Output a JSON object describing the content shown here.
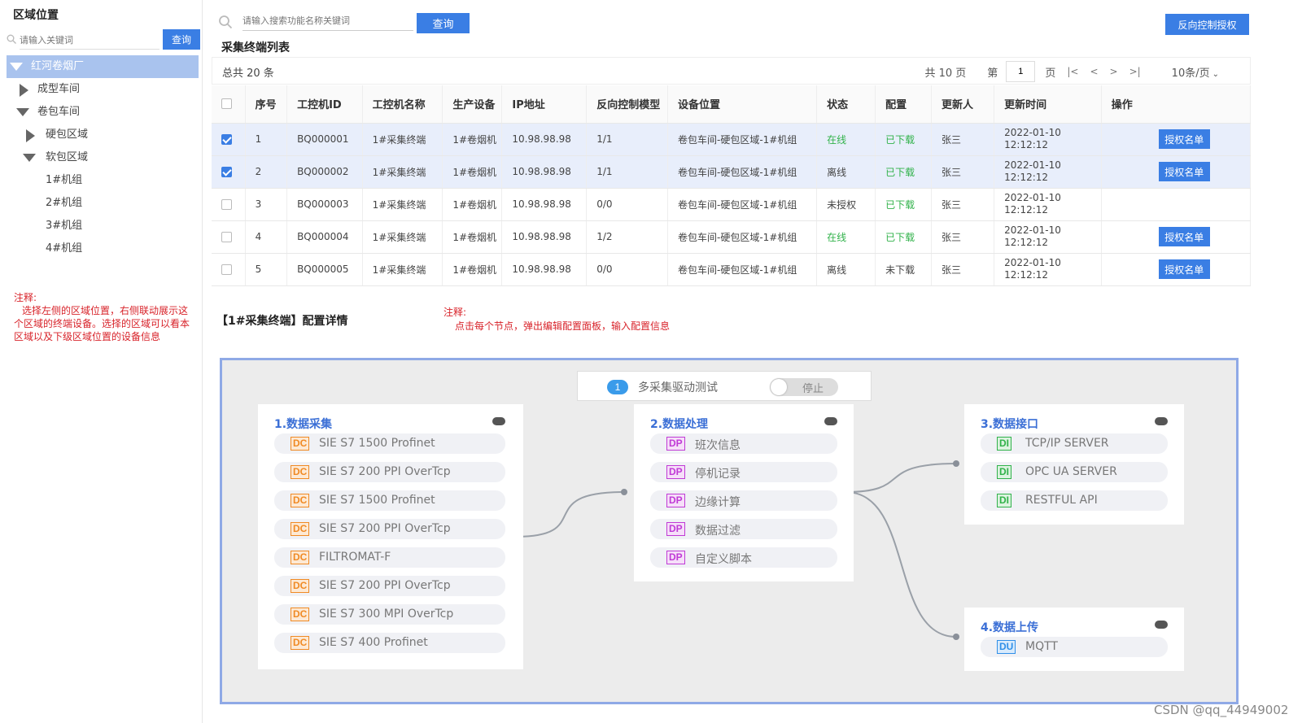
{
  "left_panel": {
    "title": "区域位置",
    "search_placeholder": "请输入关键词",
    "search_button": "查询",
    "tree": [
      {
        "label": "红河卷烟厂"
      },
      {
        "label": "成型车间"
      },
      {
        "label": "卷包车间"
      },
      {
        "label": "硬包区域"
      },
      {
        "label": "软包区域"
      },
      {
        "label": "1#机组"
      },
      {
        "label": "2#机组"
      },
      {
        "label": "3#机组"
      },
      {
        "label": "4#机组"
      }
    ],
    "note_title": "注释:",
    "note_text": "选择左侧的区域位置，右侧联动展示这个区域的终端设备。选择的区域可以看本区域以及下级区域位置的设备信息"
  },
  "top_bar": {
    "search_placeholder": "请输入搜索功能名称关键词",
    "search_button": "查询",
    "auth_button": "反向控制授权"
  },
  "list": {
    "title": "采集终端列表",
    "total": "总共 20 条",
    "pages": "共 10 页",
    "page_prefix": "第",
    "page_value": "1",
    "page_suffix": "页",
    "nav_first": "|<",
    "nav_prev": "<",
    "nav_next": ">",
    "nav_last": ">|",
    "page_size": "10条/页",
    "columns": [
      "序号",
      "工控机ID",
      "工控机名称",
      "生产设备",
      "IP地址",
      "反向控制模型",
      "设备位置",
      "状态",
      "配置",
      "更新人",
      "更新时间",
      "操作"
    ],
    "rows": [
      {
        "checked": true,
        "no": "1",
        "id": "BQ000001",
        "name": "1#采集终端",
        "device": "1#卷烟机",
        "ip": "10.98.98.98",
        "model": "1/1",
        "location": "卷包车间-硬包区域-1#机组",
        "status": "在线",
        "config": "已下载",
        "updater": "张三",
        "date": "2022-01-10",
        "time": "12:12:12",
        "action": "授权名单"
      },
      {
        "checked": true,
        "no": "2",
        "id": "BQ000002",
        "name": "1#采集终端",
        "device": "1#卷烟机",
        "ip": "10.98.98.98",
        "model": "1/1",
        "location": "卷包车间-硬包区域-1#机组",
        "status": "离线",
        "config": "已下载",
        "updater": "张三",
        "date": "2022-01-10",
        "time": "12:12:12",
        "action": "授权名单"
      },
      {
        "checked": false,
        "no": "3",
        "id": "BQ000003",
        "name": "1#采集终端",
        "device": "1#卷烟机",
        "ip": "10.98.98.98",
        "model": "0/0",
        "location": "卷包车间-硬包区域-1#机组",
        "status": "未授权",
        "config": "已下载",
        "updater": "张三",
        "date": "2022-01-10",
        "time": "12:12:12",
        "action": ""
      },
      {
        "checked": false,
        "no": "4",
        "id": "BQ000004",
        "name": "1#采集终端",
        "device": "1#卷烟机",
        "ip": "10.98.98.98",
        "model": "1/2",
        "location": "卷包车间-硬包区域-1#机组",
        "status": "在线",
        "config": "已下载",
        "updater": "张三",
        "date": "2022-01-10",
        "time": "12:12:12",
        "action": "授权名单"
      },
      {
        "checked": false,
        "no": "5",
        "id": "BQ000005",
        "name": "1#采集终端",
        "device": "1#卷烟机",
        "ip": "10.98.98.98",
        "model": "0/0",
        "location": "卷包车间-硬包区域-1#机组",
        "status": "离线",
        "config": "未下载",
        "updater": "张三",
        "date": "2022-01-10",
        "time": "12:12:12",
        "action": "授权名单"
      }
    ]
  },
  "detail": {
    "title": "【1#采集终端】配置详情",
    "note_title": "注释:",
    "note_text": "点击每个节点，弹出编辑配置面板，输入配置信息"
  },
  "flow": {
    "header": {
      "number": "1",
      "name": "多采集驱动测试",
      "toggle_label": "停止",
      "toggle_on": false
    },
    "nodes": [
      {
        "title": "1.数据采集",
        "items": [
          {
            "tag": "DC",
            "label": "SIE S7 1500 Profinet"
          },
          {
            "tag": "DC",
            "label": "SIE S7 200 PPI OverTcp"
          },
          {
            "tag": "DC",
            "label": "SIE S7 1500 Profinet"
          },
          {
            "tag": "DC",
            "label": "SIE S7 200 PPI OverTcp"
          },
          {
            "tag": "DC",
            "label": "FILTROMAT-F"
          },
          {
            "tag": "DC",
            "label": "SIE S7 200 PPI OverTcp"
          },
          {
            "tag": "DC",
            "label": "SIE S7 300 MPI OverTcp"
          },
          {
            "tag": "DC",
            "label": "SIE S7 400 Profinet"
          }
        ]
      },
      {
        "title": "2.数据处理",
        "items": [
          {
            "tag": "DP",
            "label": "班次信息"
          },
          {
            "tag": "DP",
            "label": "停机记录"
          },
          {
            "tag": "DP",
            "label": "边缘计算"
          },
          {
            "tag": "DP",
            "label": "数据过滤"
          },
          {
            "tag": "DP",
            "label": "自定义脚本"
          }
        ]
      },
      {
        "title": "3.数据接口",
        "items": [
          {
            "tag": "DI",
            "label": "TCP/IP SERVER"
          },
          {
            "tag": "DI",
            "label": "OPC UA SERVER"
          },
          {
            "tag": "DI",
            "label": "RESTFUL API"
          }
        ]
      },
      {
        "title": "4.数据上传",
        "items": [
          {
            "tag": "DU",
            "label": "MQTT"
          }
        ]
      }
    ]
  },
  "watermark": "CSDN @qq_44949002"
}
